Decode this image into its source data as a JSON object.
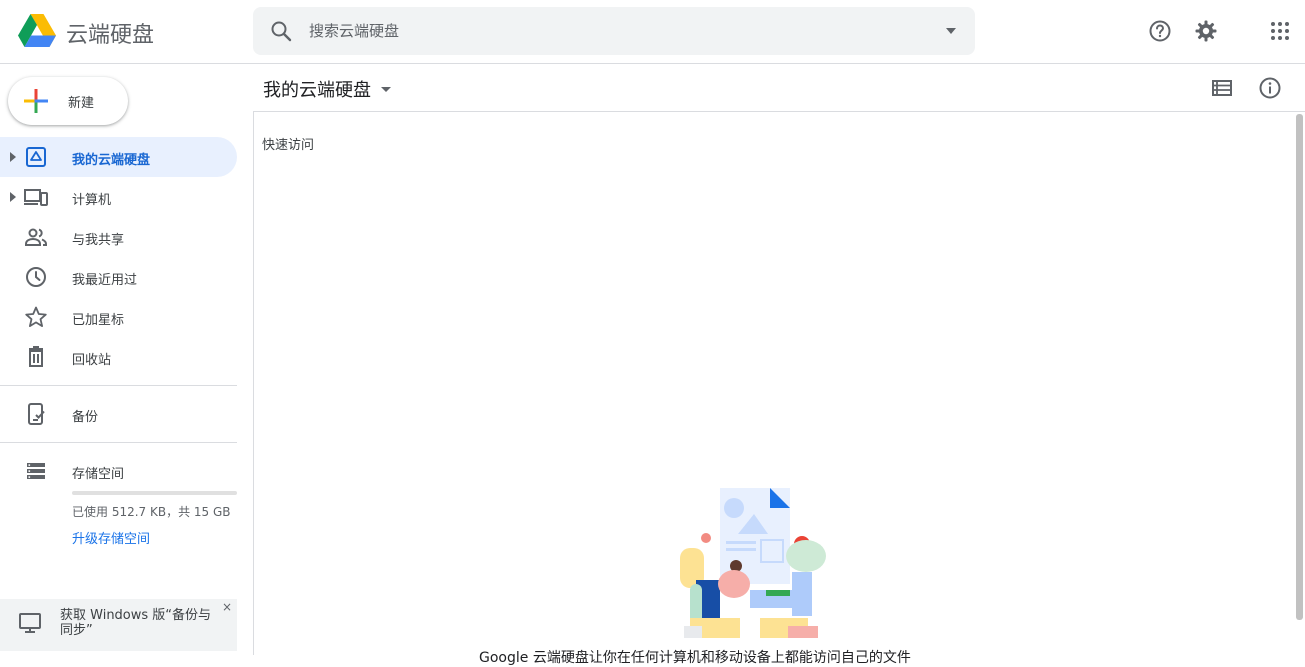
{
  "app": {
    "title": "云端硬盘",
    "search_placeholder": "搜索云端硬盘",
    "help_icon": "help-circle-icon",
    "settings_icon": "gear-icon",
    "apps_icon": "apps-grid-icon"
  },
  "sidebar": {
    "new_label": "新建",
    "items": [
      {
        "label": "我的云端硬盘",
        "icon": "drive-icon",
        "active": true,
        "expandable": true
      },
      {
        "label": "计算机",
        "icon": "computers-icon",
        "active": false,
        "expandable": true
      },
      {
        "label": "与我共享",
        "icon": "people-icon",
        "active": false,
        "expandable": false
      },
      {
        "label": "我最近用过",
        "icon": "clock-icon",
        "active": false,
        "expandable": false
      },
      {
        "label": "已加星标",
        "icon": "star-icon",
        "active": false,
        "expandable": false
      },
      {
        "label": "回收站",
        "icon": "trash-icon",
        "active": false,
        "expandable": false
      },
      {
        "label": "备份",
        "icon": "backup-icon",
        "active": false,
        "expandable": false
      }
    ],
    "storage": {
      "label": "存储空间",
      "usage": "已使用 512.7 KB，共 15 GB",
      "upgrade": "升级存储空间",
      "used_fraction": 3e-05
    },
    "promo": {
      "text": "获取 Windows 版“备份与同步”",
      "close": "×"
    }
  },
  "main": {
    "title": "我的云端硬盘",
    "quick_access": "快速访问",
    "empty_caption": "Google 云端硬盘让你在任何计算机和移动设备上都能访问自己的文件"
  },
  "colors": {
    "accent": "#1a73e8",
    "active_bg": "#e8f0fe",
    "active_text": "#1967d2"
  }
}
